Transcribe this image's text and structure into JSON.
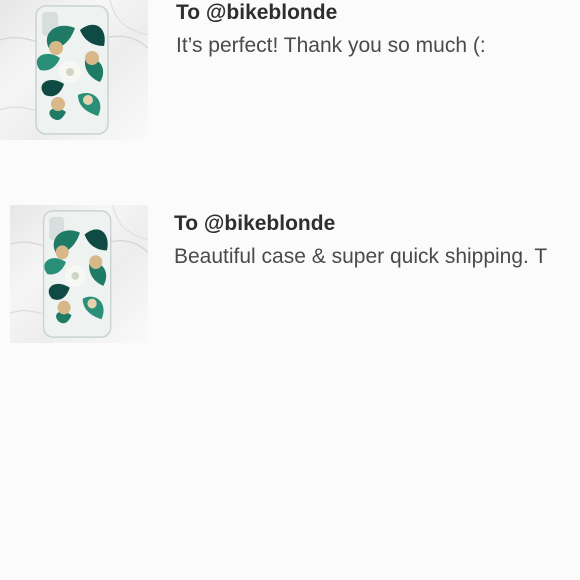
{
  "reviews": [
    {
      "recipient": "To @bikeblonde",
      "message": "It’s perfect! Thank you so much (:",
      "thumbnail_icon": "floral-phone-case-photo"
    },
    {
      "recipient": "To @bikeblonde",
      "message": "Beautiful case & super quick shipping. T",
      "thumbnail_icon": "floral-phone-case-photo"
    }
  ],
  "colors": {
    "background": "#fcfbfc",
    "recipient_text": "#2e2e2f",
    "message_text": "#4a4a4c",
    "leaf_green": "#1f7a66",
    "leaf_dark": "#0f4a44",
    "flower_gold": "#d8b889"
  }
}
